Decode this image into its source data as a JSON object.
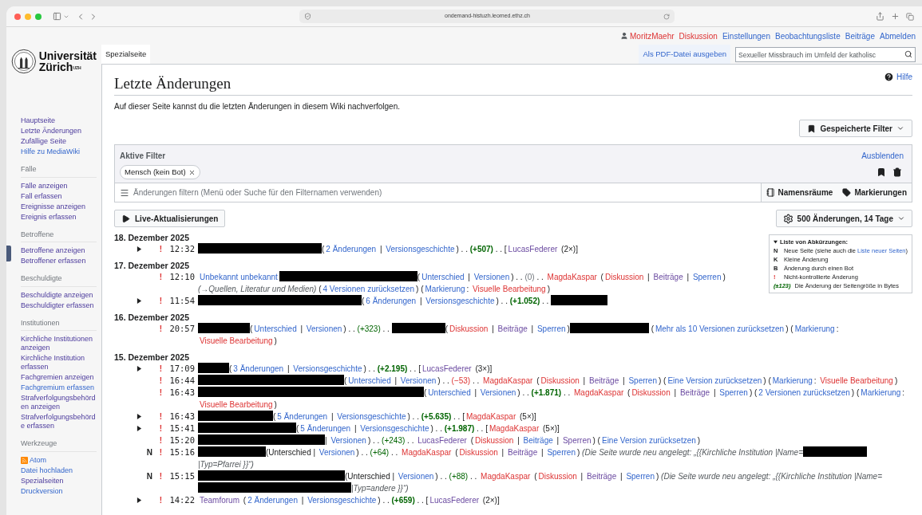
{
  "browser": {
    "url": "ondemand-histuzh.leomed.ethz.ch"
  },
  "user_bar": {
    "user": {
      "text": "MoritzMaehr",
      "kind": "redlink"
    },
    "links": [
      {
        "text": "Diskussion",
        "kind": "redlink"
      },
      {
        "text": "Einstellungen",
        "kind": "link"
      },
      {
        "text": "Beobachtungsliste",
        "kind": "link"
      },
      {
        "text": "Beiträge",
        "kind": "link"
      },
      {
        "text": "Abmelden",
        "kind": "link"
      }
    ]
  },
  "logo": {
    "line1": "Universität",
    "line2": "Zürich$^{UZH}$"
  },
  "tabs": [
    {
      "label": "Spezialseite",
      "selected": true
    }
  ],
  "actions": [
    {
      "label": "Als PDF-Datei ausgeben",
      "selected": false
    }
  ],
  "search": {
    "placeholder": "Sexueller Missbrauch im Umfeld der katholisc"
  },
  "sidebar": [
    {
      "items": [
        {
          "label": "Hauptseite",
          "visited": true
        },
        {
          "label": "Letzte Änderungen",
          "visited": true
        },
        {
          "label": "Zufällige Seite",
          "visited": true
        },
        {
          "label": "Hilfe zu MediaWiki",
          "visited": false
        }
      ]
    },
    {
      "heading": "Fälle",
      "items": [
        {
          "label": "Fälle anzeigen",
          "visited": true
        },
        {
          "label": "Fall erfassen",
          "visited": true
        },
        {
          "label": "Ereignisse anzeigen",
          "visited": true
        },
        {
          "label": "Ereignis erfassen",
          "visited": true
        }
      ]
    },
    {
      "heading": "Betroffene",
      "items": [
        {
          "label": "Betroffene anzeigen",
          "visited": true
        },
        {
          "label": "Betroffener erfassen",
          "visited": true
        }
      ]
    },
    {
      "heading": "Beschuldigte",
      "items": [
        {
          "label": "Beschuldigte anzeigen",
          "visited": true
        },
        {
          "label": "Beschuldigter erfassen",
          "visited": true
        }
      ]
    },
    {
      "heading": "Institutionen",
      "items": [
        {
          "label": "Kirchliche Institutionen anzeigen",
          "visited": true
        },
        {
          "label": "Kirchliche Institution erfassen",
          "visited": true
        },
        {
          "label": "Fachgremien anzeigen",
          "visited": true
        },
        {
          "label": "Fachgremium erfassen",
          "visited": false
        },
        {
          "label": "Strafverfolgungsbehörden anzeigen",
          "visited": true
        },
        {
          "label": "Strafverfolgungsbehörde erfassen",
          "visited": true
        }
      ]
    },
    {
      "heading": "Werkzeuge",
      "items": [
        {
          "label": "Atom",
          "visited": false,
          "kind": "feed"
        },
        {
          "label": "Datei hochladen",
          "visited": false
        },
        {
          "label": "Spezialseiten",
          "visited": true
        },
        {
          "label": "Druckversion",
          "visited": false
        }
      ]
    }
  ],
  "page": {
    "title": "Letzte Änderungen",
    "help": "Hilfe",
    "intro": "Auf dieser Seite kannst du die letzten Änderungen in diesem Wiki nachverfolgen.",
    "saved_filters": "Gespeicherte Filter",
    "active_filters": {
      "title": "Aktive Filter",
      "hide": "Ausblenden",
      "chips": [
        "Mensch (kein Bot)"
      ]
    },
    "filter_input": {
      "placeholder": "Änderungen filtern (Menü oder Suche für den Filternamen verwenden)"
    },
    "namespaces": "Namensräume",
    "tags": "Markierungen",
    "live": "Live-Aktualisierungen",
    "limit": "500 Änderungen, 14 Tage"
  },
  "legend": {
    "title": "Liste von Abkürzungen:",
    "expanded": true,
    "entries": [
      {
        "key": "N",
        "kind": "flag",
        "parts": [
          {
            "kind": "text",
            "text": "Neue Seite (siehe auch die "
          },
          {
            "kind": "link",
            "text": "Liste neuer Seiten"
          },
          {
            "kind": "text",
            "text": ")"
          }
        ]
      },
      {
        "key": "K",
        "kind": "flag",
        "parts": [
          {
            "kind": "text",
            "text": "Kleine Änderung"
          }
        ]
      },
      {
        "key": "B",
        "kind": "flag",
        "parts": [
          {
            "kind": "text",
            "text": "Änderung durch einen Bot"
          }
        ]
      },
      {
        "key": "!",
        "kind": "unpatrolled",
        "parts": [
          {
            "kind": "text",
            "text": "Nicht-kontrollierte Änderung"
          }
        ]
      },
      {
        "key": "(±123)",
        "kind": "size",
        "parts": [
          {
            "kind": "text",
            "text": "Die Änderung der Seitengröße in Bytes"
          }
        ]
      }
    ]
  },
  "days": [
    {
      "date": "18. Dezember 2025",
      "rows": [
        {
          "expanded": false,
          "marker": "!",
          "time": "12:32",
          "segments": [
            {
              "kind": "redacted"
            },
            {
              "kind": "text",
              "text": "("
            },
            {
              "kind": "link",
              "text": "2 Änderungen"
            },
            {
              "kind": "text",
              "text": " | "
            },
            {
              "kind": "link",
              "text": "Versionsgeschichte"
            },
            {
              "kind": "text",
              "text": ") . . "
            },
            {
              "kind": "plus",
              "text": "(+507)"
            },
            {
              "kind": "text",
              "text": " . . ["
            },
            {
              "kind": "visited",
              "text": "LucasFederer"
            },
            {
              "kind": "text",
              "text": " (2×)]"
            }
          ]
        }
      ]
    },
    {
      "date": "17. Dezember 2025",
      "rows": [
        {
          "marker": "!",
          "time": "12:10",
          "segments": [
            {
              "kind": "link",
              "text": "Unbekannt unbekannt"
            },
            {
              "kind": "redacted"
            },
            {
              "kind": "text",
              "text": "("
            },
            {
              "kind": "link",
              "text": "Unterschied"
            },
            {
              "kind": "text",
              "text": " | "
            },
            {
              "kind": "link",
              "text": "Versionen"
            },
            {
              "kind": "text",
              "text": ") . . "
            },
            {
              "kind": "grey",
              "text": "(0)"
            },
            {
              "kind": "text",
              "text": " . . "
            },
            {
              "kind": "redlink",
              "text": "MagdaKaspar"
            },
            {
              "kind": "text",
              "text": " ("
            },
            {
              "kind": "redlink",
              "text": "Diskussion"
            },
            {
              "kind": "text",
              "text": " | "
            },
            {
              "kind": "visited",
              "text": "Beiträge"
            },
            {
              "kind": "text",
              "text": " | "
            },
            {
              "kind": "link",
              "text": "Sperren"
            },
            {
              "kind": "text",
              "text": ") "
            },
            {
              "kind": "comment",
              "text": "(→Quellen, Literatur und Medien)"
            },
            {
              "kind": "text",
              "text": " ("
            },
            {
              "kind": "link",
              "text": "4 Versionen zurücksetzen"
            },
            {
              "kind": "text",
              "text": ") ("
            },
            {
              "kind": "link",
              "text": "Markierung"
            },
            {
              "kind": "text",
              "text": ": "
            },
            {
              "kind": "redlink",
              "text": "Visuelle Bearbeitung"
            },
            {
              "kind": "text",
              "text": ")"
            }
          ]
        },
        {
          "expanded": false,
          "marker": "!",
          "time": "11:54",
          "segments": [
            {
              "kind": "redacted"
            },
            {
              "kind": "text",
              "text": "("
            },
            {
              "kind": "link",
              "text": "6 Änderungen"
            },
            {
              "kind": "text",
              "text": " | "
            },
            {
              "kind": "link",
              "text": "Versionsgeschichte"
            },
            {
              "kind": "text",
              "text": ") . . "
            },
            {
              "kind": "plus",
              "text": "(+1.052)"
            },
            {
              "kind": "text",
              "text": " . . "
            },
            {
              "kind": "redacted"
            }
          ]
        }
      ]
    },
    {
      "date": "16. Dezember 2025",
      "rows": [
        {
          "marker": "!",
          "time": "20:57",
          "segments": [
            {
              "kind": "redacted"
            },
            {
              "kind": "text",
              "text": "("
            },
            {
              "kind": "link",
              "text": "Unterschied"
            },
            {
              "kind": "text",
              "text": " | "
            },
            {
              "kind": "link",
              "text": "Versionen"
            },
            {
              "kind": "text",
              "text": ") . . "
            },
            {
              "kind": "plus_plain",
              "text": "(+323)"
            },
            {
              "kind": "text",
              "text": " . . "
            },
            {
              "kind": "redacted"
            },
            {
              "kind": "text",
              "text": "("
            },
            {
              "kind": "redlink",
              "text": "Diskussion"
            },
            {
              "kind": "text",
              "text": " | "
            },
            {
              "kind": "visited",
              "text": "Beiträge"
            },
            {
              "kind": "text",
              "text": " | "
            },
            {
              "kind": "link",
              "text": "Sperren"
            },
            {
              "kind": "text",
              "text": ")"
            },
            {
              "kind": "redacted"
            },
            {
              "kind": "text",
              "text": " ("
            },
            {
              "kind": "link",
              "text": "Mehr als 10 Versionen zurücksetzen"
            },
            {
              "kind": "text",
              "text": ") ("
            },
            {
              "kind": "link",
              "text": "Markierung"
            },
            {
              "kind": "text",
              "text": ": "
            },
            {
              "kind": "redlink",
              "text": "Visuelle Bearbeitung"
            },
            {
              "kind": "text",
              "text": ")"
            }
          ]
        }
      ]
    },
    {
      "date": "15. Dezember 2025",
      "rows": [
        {
          "expanded": false,
          "marker": "!",
          "time": "17:09",
          "segments": [
            {
              "kind": "redacted"
            },
            {
              "kind": "text",
              "text": "("
            },
            {
              "kind": "link",
              "text": "3 Änderungen"
            },
            {
              "kind": "text",
              "text": " | "
            },
            {
              "kind": "link",
              "text": "Versionsgeschichte"
            },
            {
              "kind": "text",
              "text": ") . . "
            },
            {
              "kind": "plus",
              "text": "(+2.195)"
            },
            {
              "kind": "text",
              "text": " . . ["
            },
            {
              "kind": "visited",
              "text": "LucasFederer"
            },
            {
              "kind": "text",
              "text": " (3×)]"
            }
          ]
        },
        {
          "marker": "!",
          "time": "16:44",
          "segments": [
            {
              "kind": "redacted"
            },
            {
              "kind": "text",
              "text": "("
            },
            {
              "kind": "link",
              "text": "Unterschied"
            },
            {
              "kind": "text",
              "text": " | "
            },
            {
              "kind": "link",
              "text": "Versionen"
            },
            {
              "kind": "text",
              "text": ") . . "
            },
            {
              "kind": "minus",
              "text": "(−53)"
            },
            {
              "kind": "text",
              "text": " . . "
            },
            {
              "kind": "redlink",
              "text": "MagdaKaspar"
            },
            {
              "kind": "text",
              "text": " ("
            },
            {
              "kind": "redlink",
              "text": "Diskussion"
            },
            {
              "kind": "text",
              "text": " | "
            },
            {
              "kind": "visited",
              "text": "Beiträge"
            },
            {
              "kind": "text",
              "text": " | "
            },
            {
              "kind": "link",
              "text": "Sperren"
            },
            {
              "kind": "text",
              "text": ") ("
            },
            {
              "kind": "link",
              "text": "Eine Version zurücksetzen"
            },
            {
              "kind": "text",
              "text": ") ("
            },
            {
              "kind": "link",
              "text": "Markierung"
            },
            {
              "kind": "text",
              "text": ": "
            },
            {
              "kind": "redlink",
              "text": "Visuelle Bearbeitung"
            },
            {
              "kind": "text",
              "text": ")"
            }
          ]
        },
        {
          "marker": "!",
          "time": "16:43",
          "segments": [
            {
              "kind": "redacted"
            },
            {
              "kind": "text",
              "text": "("
            },
            {
              "kind": "link",
              "text": "Unterschied"
            },
            {
              "kind": "text",
              "text": " | "
            },
            {
              "kind": "link",
              "text": "Versionen"
            },
            {
              "kind": "text",
              "text": ") . . "
            },
            {
              "kind": "plus",
              "text": "(+1.871)"
            },
            {
              "kind": "text",
              "text": " . . "
            },
            {
              "kind": "redlink",
              "text": "MagdaKaspar"
            },
            {
              "kind": "text",
              "text": " ("
            },
            {
              "kind": "redlink",
              "text": "Diskussion"
            },
            {
              "kind": "text",
              "text": " | "
            },
            {
              "kind": "visited",
              "text": "Beiträge"
            },
            {
              "kind": "text",
              "text": " | "
            },
            {
              "kind": "link",
              "text": "Sperren"
            },
            {
              "kind": "text",
              "text": ") ("
            },
            {
              "kind": "link",
              "text": "2 Versionen zurücksetzen"
            },
            {
              "kind": "text",
              "text": ") ("
            },
            {
              "kind": "link",
              "text": "Markierung"
            },
            {
              "kind": "text",
              "text": ": "
            },
            {
              "kind": "redlink",
              "text": "Visuelle Bearbeitung"
            },
            {
              "kind": "text",
              "text": ")"
            }
          ]
        },
        {
          "expanded": false,
          "marker": "!",
          "time": "16:43",
          "segments": [
            {
              "kind": "redacted"
            },
            {
              "kind": "text",
              "text": "("
            },
            {
              "kind": "link",
              "text": "5 Änderungen"
            },
            {
              "kind": "text",
              "text": " | "
            },
            {
              "kind": "link",
              "text": "Versionsgeschichte"
            },
            {
              "kind": "text",
              "text": ") . . "
            },
            {
              "kind": "plus",
              "text": "(+5.635)"
            },
            {
              "kind": "text",
              "text": " . . ["
            },
            {
              "kind": "redlink",
              "text": "MagdaKaspar"
            },
            {
              "kind": "text",
              "text": " (5×)]"
            }
          ]
        },
        {
          "expanded": false,
          "marker": "!",
          "time": "15:41",
          "segments": [
            {
              "kind": "redacted"
            },
            {
              "kind": "text",
              "text": "("
            },
            {
              "kind": "link",
              "text": "5 Änderungen"
            },
            {
              "kind": "text",
              "text": " | "
            },
            {
              "kind": "link",
              "text": "Versionsgeschichte"
            },
            {
              "kind": "text",
              "text": ") . . "
            },
            {
              "kind": "plus",
              "text": "(+1.987)"
            },
            {
              "kind": "text",
              "text": " . . ["
            },
            {
              "kind": "redlink",
              "text": "MagdaKaspar"
            },
            {
              "kind": "text",
              "text": " (5×)]"
            }
          ]
        },
        {
          "marker": "!",
          "time": "15:20",
          "segments": [
            {
              "kind": "redacted"
            },
            {
              "kind": "text",
              "text": "| "
            },
            {
              "kind": "link",
              "text": "Versionen"
            },
            {
              "kind": "text",
              "text": ") . . "
            },
            {
              "kind": "plus_plain",
              "text": "(+243)"
            },
            {
              "kind": "text",
              "text": " . . "
            },
            {
              "kind": "visited",
              "text": "LucasFederer"
            },
            {
              "kind": "text",
              "text": " ("
            },
            {
              "kind": "redlink",
              "text": "Diskussion"
            },
            {
              "kind": "text",
              "text": " | "
            },
            {
              "kind": "link",
              "text": "Beiträge"
            },
            {
              "kind": "text",
              "text": " | "
            },
            {
              "kind": "visited",
              "text": "Sperren"
            },
            {
              "kind": "text",
              "text": ") ("
            },
            {
              "kind": "link",
              "text": "Eine Version zurücksetzen"
            },
            {
              "kind": "text",
              "text": ")"
            }
          ]
        },
        {
          "flag": "N",
          "marker": "!",
          "time": "15:16",
          "segments": [
            {
              "kind": "redacted"
            },
            {
              "kind": "text",
              "text": "(Unterschied | "
            },
            {
              "kind": "link",
              "text": "Versionen"
            },
            {
              "kind": "text",
              "text": ") . . "
            },
            {
              "kind": "plus_plain",
              "text": "(+64)"
            },
            {
              "kind": "text",
              "text": " . . "
            },
            {
              "kind": "redlink",
              "text": "MagdaKaspar"
            },
            {
              "kind": "text",
              "text": " ("
            },
            {
              "kind": "redlink",
              "text": "Diskussion"
            },
            {
              "kind": "text",
              "text": " | "
            },
            {
              "kind": "visited",
              "text": "Beiträge"
            },
            {
              "kind": "text",
              "text": " | "
            },
            {
              "kind": "link",
              "text": "Sperren"
            },
            {
              "kind": "text",
              "text": ") "
            },
            {
              "kind": "comment",
              "text": "(Die Seite wurde neu angelegt: „{{Kirchliche Institution |Name="
            },
            {
              "kind": "redacted"
            },
            {
              "kind": "comment",
              "text": "|Typ=Pfarrei }}“)"
            }
          ]
        },
        {
          "flag": "N",
          "marker": "!",
          "time": "15:15",
          "segments": [
            {
              "kind": "redacted"
            },
            {
              "kind": "text",
              "text": "(Unterschied | "
            },
            {
              "kind": "link",
              "text": "Versionen"
            },
            {
              "kind": "text",
              "text": ") . . "
            },
            {
              "kind": "plus_plain",
              "text": "(+88)"
            },
            {
              "kind": "text",
              "text": " . . "
            },
            {
              "kind": "redlink",
              "text": "MagdaKaspar"
            },
            {
              "kind": "text",
              "text": " ("
            },
            {
              "kind": "redlink",
              "text": "Diskussion"
            },
            {
              "kind": "text",
              "text": " | "
            },
            {
              "kind": "visited",
              "text": "Beiträge"
            },
            {
              "kind": "text",
              "text": " | "
            },
            {
              "kind": "link",
              "text": "Sperren"
            },
            {
              "kind": "text",
              "text": ") "
            },
            {
              "kind": "comment",
              "text": "(Die Seite wurde neu angelegt: „{{Kirchliche Institution |Name="
            },
            {
              "kind": "redacted"
            },
            {
              "kind": "redacted"
            },
            {
              "kind": "comment",
              "text": "|Typ=andere }}“)"
            }
          ]
        },
        {
          "expanded": false,
          "marker": "!",
          "time": "14:22",
          "segments": [
            {
              "kind": "visited",
              "text": "Teamforum"
            },
            {
              "kind": "text",
              "text": " ("
            },
            {
              "kind": "link",
              "text": "2 Änderungen"
            },
            {
              "kind": "text",
              "text": " | "
            },
            {
              "kind": "link",
              "text": "Versionsgeschichte"
            },
            {
              "kind": "text",
              "text": ") . . "
            },
            {
              "kind": "plus",
              "text": "(+659)"
            },
            {
              "kind": "text",
              "text": " . . ["
            },
            {
              "kind": "visited",
              "text": "LucasFederer"
            },
            {
              "kind": "text",
              "text": " (2×)]"
            }
          ]
        }
      ]
    }
  ]
}
